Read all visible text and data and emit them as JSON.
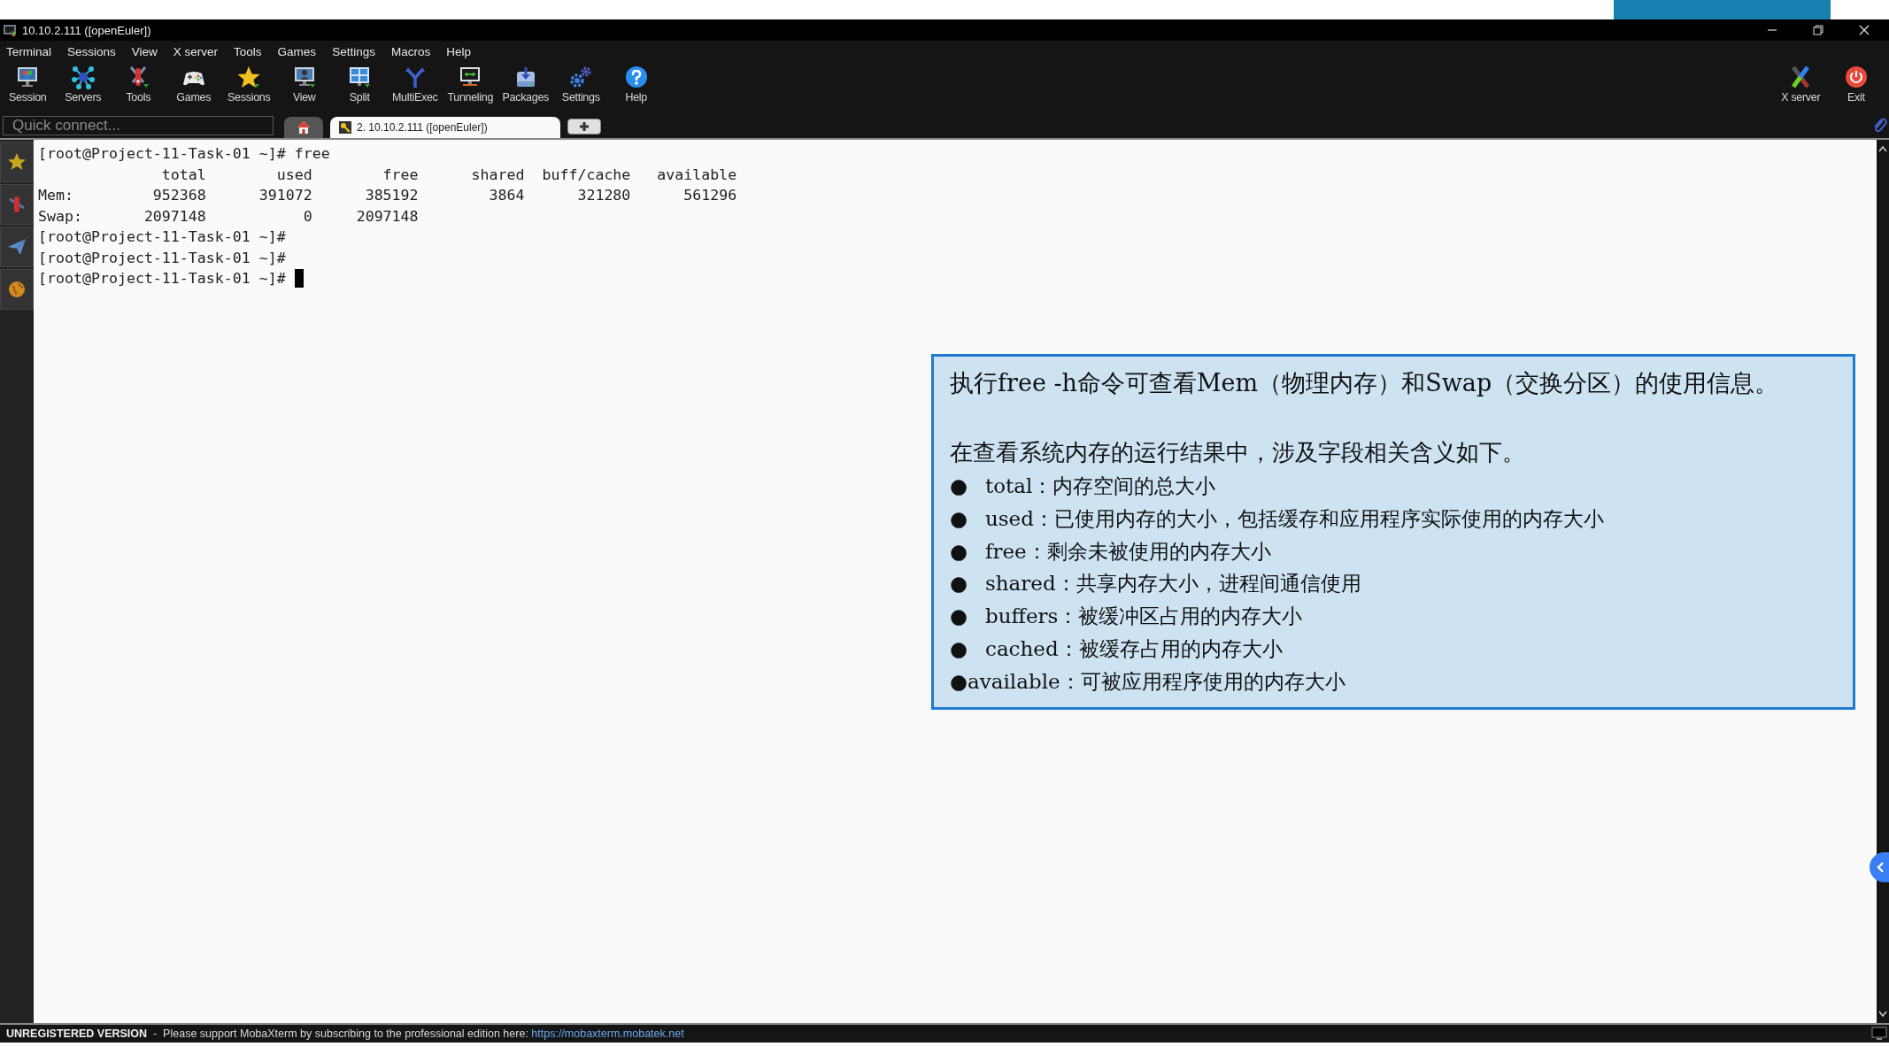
{
  "window": {
    "title": "10.10.2.111 ([openEuler])"
  },
  "menu": [
    "Terminal",
    "Sessions",
    "View",
    "X server",
    "Tools",
    "Games",
    "Settings",
    "Macros",
    "Help"
  ],
  "toolbar": {
    "left": [
      {
        "label": "Session"
      },
      {
        "label": "Servers"
      },
      {
        "label": "Tools"
      },
      {
        "label": "Games"
      },
      {
        "label": "Sessions"
      },
      {
        "label": "View"
      },
      {
        "label": "Split"
      },
      {
        "label": "MultiExec"
      },
      {
        "label": "Tunneling"
      },
      {
        "label": "Packages"
      },
      {
        "label": "Settings"
      },
      {
        "label": "Help"
      }
    ],
    "right": [
      {
        "label": "X server"
      },
      {
        "label": "Exit"
      }
    ]
  },
  "quick_connect": {
    "placeholder": "Quick connect..."
  },
  "tabs": [
    {
      "kind": "home",
      "selected": false
    },
    {
      "kind": "session",
      "label": "2. 10.10.2.111 ([openEuler])",
      "selected": true
    },
    {
      "kind": "new",
      "selected": false
    }
  ],
  "terminal": {
    "lines": [
      "[root@Project-11-Task-01 ~]# free",
      "              total        used        free      shared  buff/cache   available",
      "Mem:         952368      391072      385192        3864      321280      561296",
      "Swap:       2097148           0     2097148",
      "[root@Project-11-Task-01 ~]#",
      "[root@Project-11-Task-01 ~]#",
      "[root@Project-11-Task-01 ~]# "
    ],
    "cursor": true
  },
  "note": {
    "title": "执行free -h命令可查看Mem（物理内存）和Swap（交换分区）的使用信息。",
    "heading": "在查看系统内存的运行结果中，涉及字段相关含义如下。",
    "items": [
      {
        "marker": "●",
        "text": "total：内存空间的总大小",
        "kind": "spaced"
      },
      {
        "marker": "●",
        "text": "used：已使用内存的大小，包括缓存和应用程序实际使用的内存大小",
        "kind": "spaced"
      },
      {
        "marker": "●",
        "text": "free：剩余未被使用的内存大小",
        "kind": "spaced"
      },
      {
        "marker": "●",
        "text": "shared：共享内存大小，进程间通信使用",
        "kind": "spaced"
      },
      {
        "marker": "●",
        "text": "buffers：被缓冲区占用的内存大小",
        "kind": "spaced"
      },
      {
        "marker": "●",
        "text": "cached：被缓存占用的内存大小",
        "kind": "spaced"
      },
      {
        "marker": "●",
        "text": "available：可被应用程序使用的内存大小",
        "kind": "tight"
      }
    ]
  },
  "status_bar": {
    "notice": "**UNREGISTERED VERSION**  -  Please support MobaXterm by subscribing to the professional edition here:",
    "link": "https://mobaxterm.mobatek.net"
  }
}
